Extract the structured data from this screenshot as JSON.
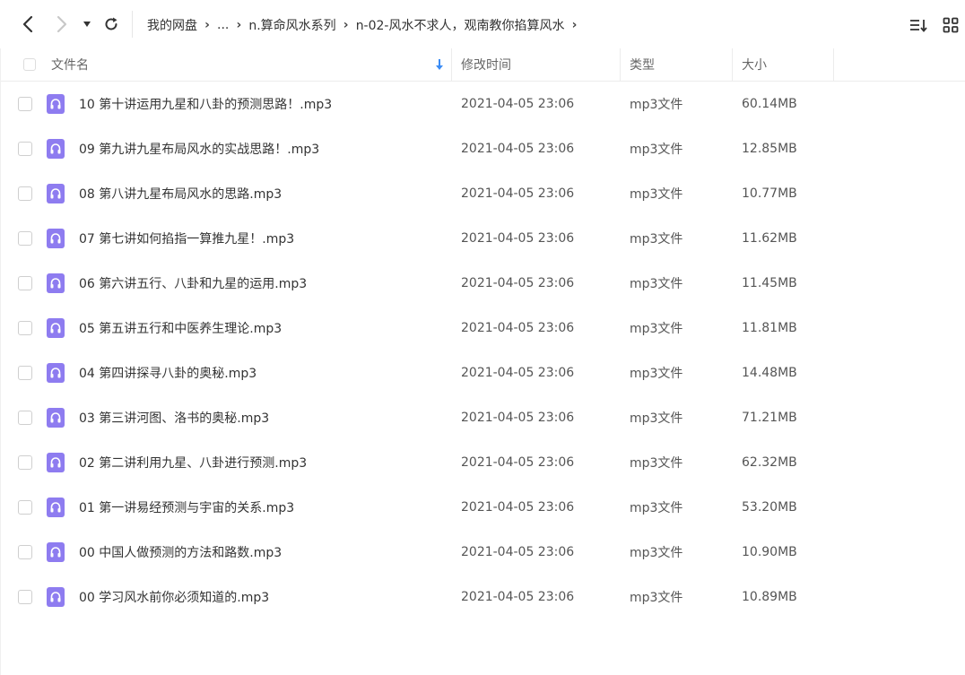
{
  "breadcrumb": [
    {
      "label": "我的网盘"
    },
    {
      "label": "..."
    },
    {
      "label": "n.算命风水系列"
    },
    {
      "label": "n-02-风水不求人，观南教你掐算风水"
    }
  ],
  "columns": {
    "name": "文件名",
    "modified": "修改时间",
    "type": "类型",
    "size": "大小"
  },
  "files": [
    {
      "name": "10 第十讲运用九星和八卦的预测思路！.mp3",
      "modified": "2021-04-05 23:06",
      "type": "mp3文件",
      "size": "60.14MB"
    },
    {
      "name": "09 第九讲九星布局风水的实战思路！.mp3",
      "modified": "2021-04-05 23:06",
      "type": "mp3文件",
      "size": "12.85MB"
    },
    {
      "name": "08 第八讲九星布局风水的思路.mp3",
      "modified": "2021-04-05 23:06",
      "type": "mp3文件",
      "size": "10.77MB"
    },
    {
      "name": "07 第七讲如何掐指一算推九星！.mp3",
      "modified": "2021-04-05 23:06",
      "type": "mp3文件",
      "size": "11.62MB"
    },
    {
      "name": "06 第六讲五行、八卦和九星的运用.mp3",
      "modified": "2021-04-05 23:06",
      "type": "mp3文件",
      "size": "11.45MB"
    },
    {
      "name": "05 第五讲五行和中医养生理论.mp3",
      "modified": "2021-04-05 23:06",
      "type": "mp3文件",
      "size": "11.81MB"
    },
    {
      "name": "04 第四讲探寻八卦的奥秘.mp3",
      "modified": "2021-04-05 23:06",
      "type": "mp3文件",
      "size": "14.48MB"
    },
    {
      "name": "03 第三讲河图、洛书的奥秘.mp3",
      "modified": "2021-04-05 23:06",
      "type": "mp3文件",
      "size": "71.21MB"
    },
    {
      "name": "02 第二讲利用九星、八卦进行预测.mp3",
      "modified": "2021-04-05 23:06",
      "type": "mp3文件",
      "size": "62.32MB"
    },
    {
      "name": "01 第一讲易经预测与宇宙的关系.mp3",
      "modified": "2021-04-05 23:06",
      "type": "mp3文件",
      "size": "53.20MB"
    },
    {
      "name": "00 中国人做预测的方法和路数.mp3",
      "modified": "2021-04-05 23:06",
      "type": "mp3文件",
      "size": "10.90MB"
    },
    {
      "name": "00 学习风水前你必须知道的.mp3",
      "modified": "2021-04-05 23:06",
      "type": "mp3文件",
      "size": "10.89MB"
    }
  ],
  "icons": {
    "back": "chevron-left-icon",
    "forward": "chevron-right-icon",
    "history": "caret-down-icon",
    "refresh": "refresh-icon",
    "sort": "sort-list-icon",
    "grid": "grid-view-icon",
    "file": "audio-file-icon",
    "sort_indicator": "arrow-down-icon"
  },
  "colors": {
    "accent": "#3b8cf5",
    "audio_icon": "#8e7cf0",
    "audio_icon_light": "#b9adf7"
  }
}
